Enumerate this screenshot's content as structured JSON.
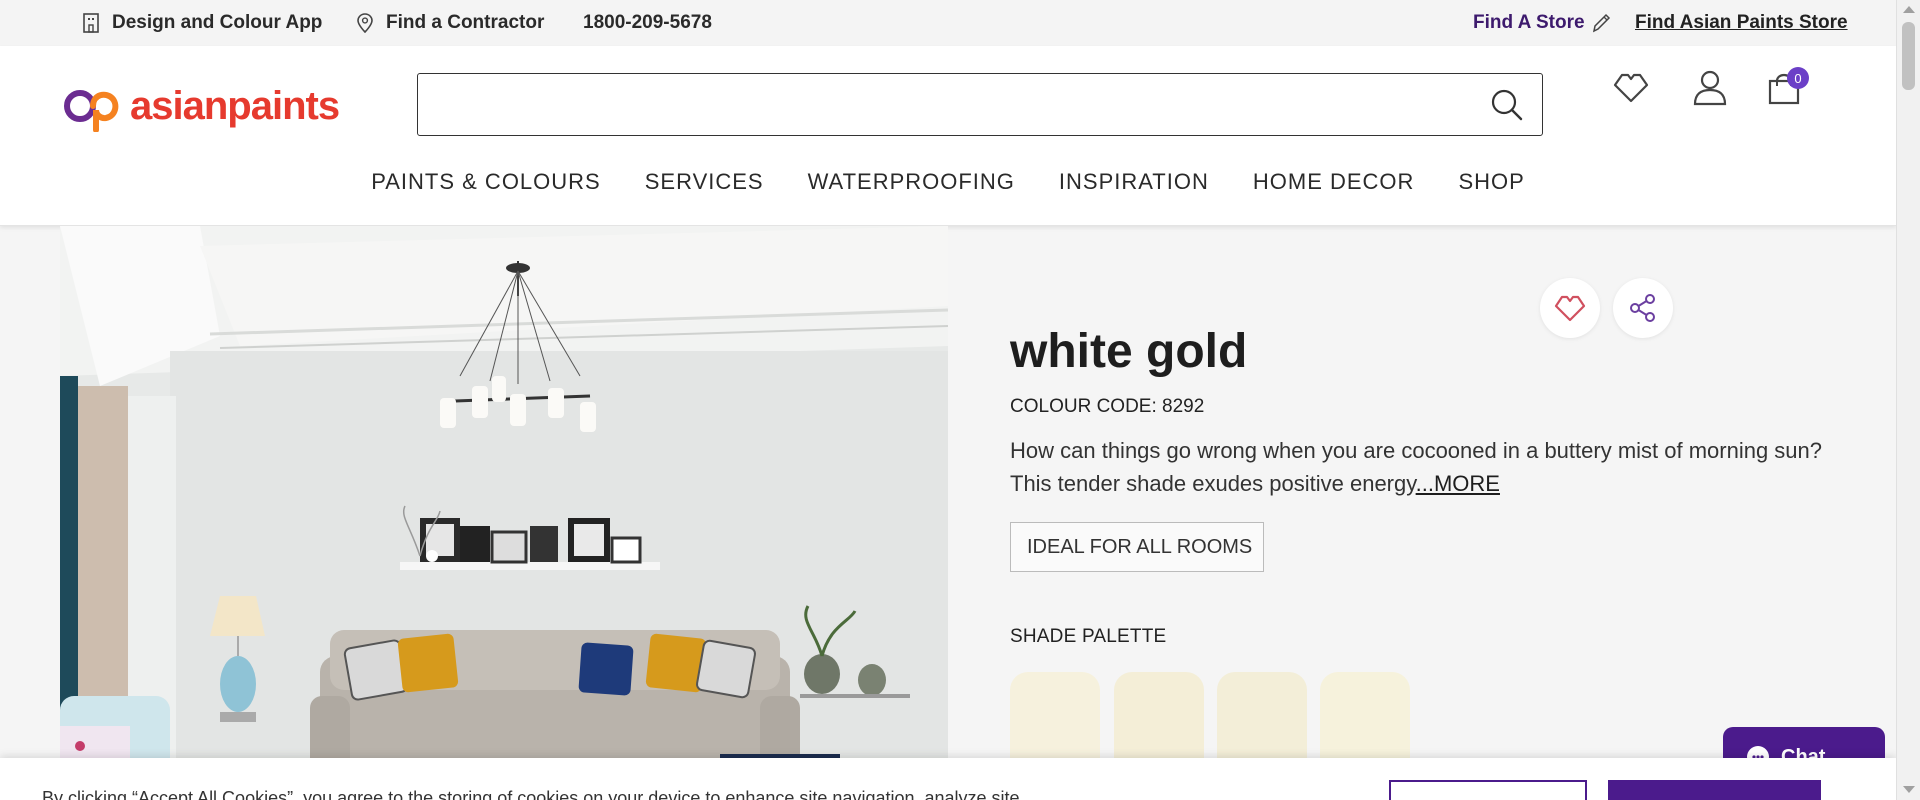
{
  "utility_bar": {
    "design_app": "Design and Colour App",
    "find_contractor": "Find a Contractor",
    "phone": "1800-209-5678",
    "find_a_store": "Find A Store",
    "find_ap_store": "Find Asian Paints Store"
  },
  "header": {
    "logo_text": "asianpaints",
    "search_placeholder": "",
    "cart_count": "0",
    "icons": [
      "wishlist-icon",
      "user-icon",
      "cart-icon"
    ]
  },
  "nav": {
    "items": [
      "PAINTS & COLOURS",
      "SERVICES",
      "WATERPROOFING",
      "INSPIRATION",
      "HOME DECOR",
      "SHOP"
    ]
  },
  "product": {
    "name": "white gold",
    "colour_code": "COLOUR CODE: 8292",
    "description": "How can things go wrong when you are cocooned in a buttery mist of morning sun? This tender shade exudes positive energy",
    "more_label": "...MORE",
    "ideal_for": "IDEAL FOR ALL ROOMS",
    "palette_label": "SHADE PALETTE",
    "palette_colors": [
      "#f6f1dd",
      "#f4eed7",
      "#f3eed8",
      "#f6f2dc"
    ]
  },
  "chat": {
    "label": "Chat"
  },
  "cookie": {
    "text": "By clicking “Accept All Cookies”, you agree to the storing of cookies on your device to enhance site navigation, analyze site"
  },
  "colors": {
    "brand_purple": "#4b1b8c",
    "logo_red": "#e63a2e",
    "logo_orange": "#f58220"
  }
}
